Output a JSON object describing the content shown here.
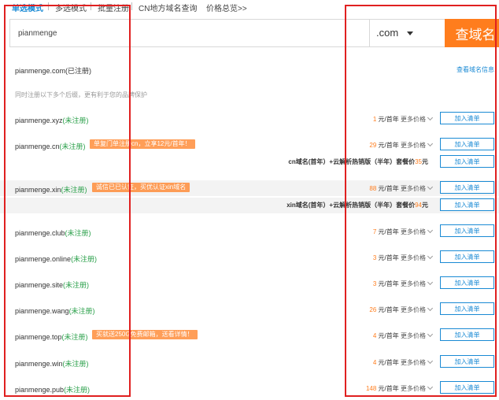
{
  "tabs": [
    {
      "label": "单选模式"
    },
    {
      "label": "多选模式"
    },
    {
      "label": "批量注册"
    },
    {
      "label": "CN地方域名查询"
    },
    {
      "label": "价格总览>>"
    }
  ],
  "search": {
    "value": "pianmenge",
    "suffix": ".com",
    "button": "查域名"
  },
  "main_result": {
    "domain": "pianmenge.com",
    "status": "(已注册)",
    "link": "查看域名信息"
  },
  "hint": "同时注册以下多个后缀，更有利于您的品牌保护",
  "results": [
    {
      "domain": "pianmenge.xyz",
      "status": "(未注册)",
      "promo": "",
      "price": "1",
      "unit": "元/首年",
      "more": "更多价格",
      "button": "加入清单"
    },
    {
      "domain": "pianmenge.cn",
      "status": "(未注册)",
      "promo": "单复门单注册cn，立享12元/首年！",
      "price": "29",
      "unit": "元/首年",
      "more": "更多价格",
      "button": "加入清单",
      "bundle": {
        "text": "cn域名(首年）+云解析热销版（半年）套餐价",
        "price": "35",
        "unit": "元",
        "button": "加入清单"
      }
    },
    {
      "domain": "pianmenge.xin",
      "status": "(未注册)",
      "promo": "诚信已已认证，买优认证xin域名",
      "price": "88",
      "unit": "元/首年",
      "more": "更多价格",
      "button": "加入清单",
      "bundle": {
        "text": "xin域名(首年）+云解析热销版（半年）套餐价",
        "price": "94",
        "unit": "元",
        "button": "加入清单"
      }
    },
    {
      "domain": "pianmenge.club",
      "status": "(未注册)",
      "promo": "",
      "price": "7",
      "unit": "元/首年",
      "more": "更多价格",
      "button": "加入清单"
    },
    {
      "domain": "pianmenge.online",
      "status": "(未注册)",
      "promo": "",
      "price": "3",
      "unit": "元/首年",
      "more": "更多价格",
      "button": "加入清单"
    },
    {
      "domain": "pianmenge.site",
      "status": "(未注册)",
      "promo": "",
      "price": "3",
      "unit": "元/首年",
      "more": "更多价格",
      "button": "加入清单"
    },
    {
      "domain": "pianmenge.wang",
      "status": "(未注册)",
      "promo": "",
      "price": "26",
      "unit": "元/首年",
      "more": "更多价格",
      "button": "加入清单"
    },
    {
      "domain": "pianmenge.top",
      "status": "(未注册)",
      "promo": "买就送250G免费邮箱，送看详情！",
      "price": "4",
      "unit": "元/首年",
      "more": "更多价格",
      "button": "加入清单"
    },
    {
      "domain": "pianmenge.win",
      "status": "(未注册)",
      "promo": "",
      "price": "4",
      "unit": "元/首年",
      "more": "更多价格",
      "button": "加入清单"
    },
    {
      "domain": "pianmenge.pub",
      "status": "(未注册)",
      "promo": "",
      "price": "148",
      "unit": "元/首年",
      "more": "更多价格",
      "button": "加入清单"
    }
  ],
  "colors": {
    "accent": "#1a8ad4",
    "orange": "#ff7d1d",
    "registered_green": "#2aa04a",
    "highlight_red": "#e02020"
  }
}
